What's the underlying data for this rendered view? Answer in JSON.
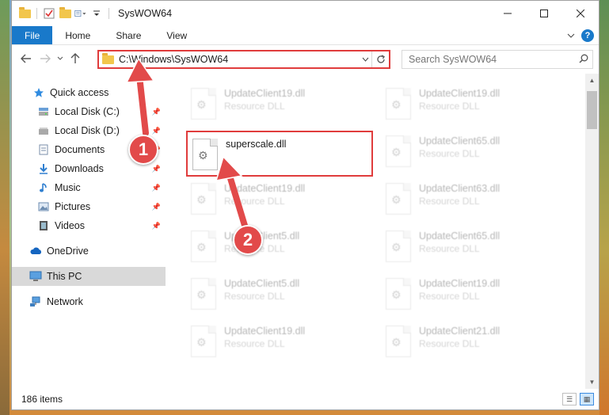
{
  "window": {
    "title": "SysWOW64"
  },
  "ribbon": {
    "tabs": [
      "File",
      "Home",
      "Share",
      "View"
    ]
  },
  "address": {
    "path": "C:\\Windows\\SysWOW64"
  },
  "search": {
    "placeholder": "Search SysWOW64"
  },
  "sidebar": {
    "items": [
      {
        "label": "Quick access",
        "icon": "star-icon"
      },
      {
        "label": "Local Disk (C:)",
        "icon": "drive-icon",
        "pinned": true
      },
      {
        "label": "Local Disk (D:)",
        "icon": "drive-icon",
        "pinned": true
      },
      {
        "label": "Documents",
        "icon": "documents-icon",
        "pinned": true
      },
      {
        "label": "Downloads",
        "icon": "download-icon",
        "pinned": true
      },
      {
        "label": "Music",
        "icon": "music-icon",
        "pinned": true
      },
      {
        "label": "Pictures",
        "icon": "pictures-icon",
        "pinned": true
      },
      {
        "label": "Videos",
        "icon": "videos-icon",
        "pinned": true
      },
      {
        "label": "OneDrive",
        "icon": "cloud-icon"
      },
      {
        "label": "This PC",
        "icon": "computer-icon",
        "selected": true
      },
      {
        "label": "Network",
        "icon": "network-icon"
      }
    ]
  },
  "files": {
    "left": [
      {
        "name": "UpdateClient19.dll",
        "type": "Resource DLL"
      },
      {
        "name": "superscale.dll",
        "type": ""
      },
      {
        "name": "UpdateClient19.dll",
        "type": "Resource DLL"
      },
      {
        "name": "UpdateClient5.dll",
        "type": "Resource DLL"
      },
      {
        "name": "UpdateClient5.dll",
        "type": "Resource DLL"
      },
      {
        "name": "UpdateClient19.dll",
        "type": "Resource DLL"
      }
    ],
    "right": [
      {
        "name": "UpdateClient19.dll",
        "type": "Resource DLL"
      },
      {
        "name": "UpdateClient65.dll",
        "type": "Resource DLL"
      },
      {
        "name": "UpdateClient63.dll",
        "type": "Resource DLL"
      },
      {
        "name": "UpdateClient65.dll",
        "type": "Resource DLL"
      },
      {
        "name": "UpdateClient19.dll",
        "type": "Resource DLL"
      },
      {
        "name": "UpdateClient21.dll",
        "type": "Resource DLL"
      }
    ]
  },
  "status": {
    "item_count": "186 items"
  },
  "annotations": {
    "badge1": "1",
    "badge2": "2",
    "color": "#e24a4a"
  }
}
